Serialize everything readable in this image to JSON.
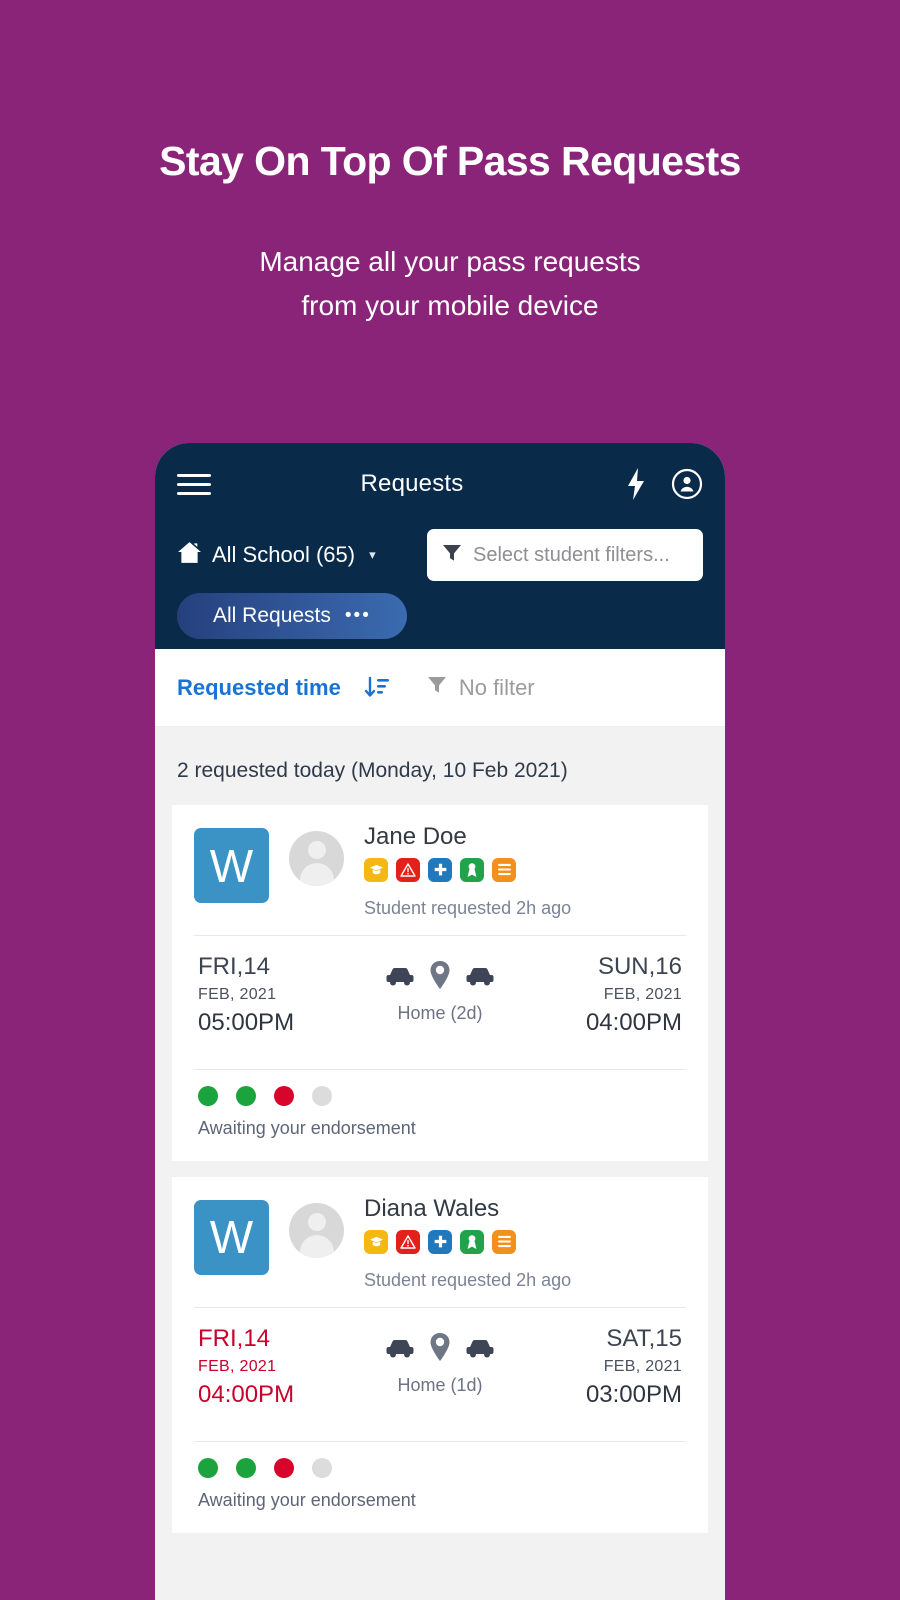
{
  "promo": {
    "title": "Stay On Top Of Pass Requests",
    "subtitle_line1": "Manage all your pass requests",
    "subtitle_line2": "from your mobile device"
  },
  "colors": {
    "background_purple": "#8A2479",
    "appbar_navy": "#0A2A4A",
    "pill_blue": "#3b6bb0",
    "accent_blue": "#1a73d4",
    "logo_blue": "#3A93C4",
    "alert_red": "#c9002b",
    "status_green": "#1ba33d",
    "status_grey": "#dcdcdc"
  },
  "appbar": {
    "menu_icon": "hamburger-icon",
    "title": "Requests",
    "bolt_icon": "lightning-bolt-icon",
    "profile_icon": "account-circle-icon",
    "school_icon": "home-icon",
    "school_label": "All School (65)",
    "school_caret": "▾",
    "filter_icon": "funnel-icon",
    "filter_placeholder": "Select student filters...",
    "requests_pill_label": "All Requests",
    "requests_pill_dots": "•••"
  },
  "sortbar": {
    "sort_label": "Requested time",
    "sort_icon": "sort-descending-icon",
    "filter_icon": "funnel-icon",
    "filter_label": "No filter"
  },
  "list": {
    "day_group_label": "2 requested today (Monday, 10 Feb 2021)",
    "cards": [
      {
        "school_initial": "W",
        "avatar": "student-avatar",
        "student_name": "Jane Doe",
        "badges": [
          {
            "name": "graduation-cap-badge",
            "color": "#f5b811"
          },
          {
            "name": "warning-triangle-badge",
            "color": "#e32119"
          },
          {
            "name": "medical-plus-badge",
            "color": "#1f79bc"
          },
          {
            "name": "award-medal-badge",
            "color": "#22a24a"
          },
          {
            "name": "notes-list-badge",
            "color": "#f2901e"
          }
        ],
        "request_meta": "Student requested 2h ago",
        "depart": {
          "day": "FRI,14",
          "month": "FEB, 2021",
          "time": "05:00PM",
          "alert": false
        },
        "return": {
          "day": "SUN,16",
          "month": "FEB, 2021",
          "time": "04:00PM",
          "alert": false
        },
        "trip_icons": [
          "car-icon",
          "location-pin-icon",
          "car-icon"
        ],
        "destination": "Home (2d)",
        "status_dots": [
          "#1ba33d",
          "#1ba33d",
          "#d9042b",
          "#dcdcdc"
        ],
        "status_text": "Awaiting your endorsement"
      },
      {
        "school_initial": "W",
        "avatar": "student-avatar",
        "student_name": "Diana Wales",
        "badges": [
          {
            "name": "graduation-cap-badge",
            "color": "#f5b811"
          },
          {
            "name": "warning-triangle-badge",
            "color": "#e32119"
          },
          {
            "name": "medical-plus-badge",
            "color": "#1f79bc"
          },
          {
            "name": "award-medal-badge",
            "color": "#22a24a"
          },
          {
            "name": "notes-list-badge",
            "color": "#f2901e"
          }
        ],
        "request_meta": "Student requested 2h ago",
        "depart": {
          "day": "FRI,14",
          "month": "FEB, 2021",
          "time": "04:00PM",
          "alert": true
        },
        "return": {
          "day": "SAT,15",
          "month": "FEB, 2021",
          "time": "03:00PM",
          "alert": false
        },
        "trip_icons": [
          "car-icon",
          "location-pin-icon",
          "car-icon"
        ],
        "destination": "Home (1d)",
        "status_dots": [
          "#1ba33d",
          "#1ba33d",
          "#d9042b",
          "#dcdcdc"
        ],
        "status_text": "Awaiting your endorsement"
      }
    ]
  }
}
